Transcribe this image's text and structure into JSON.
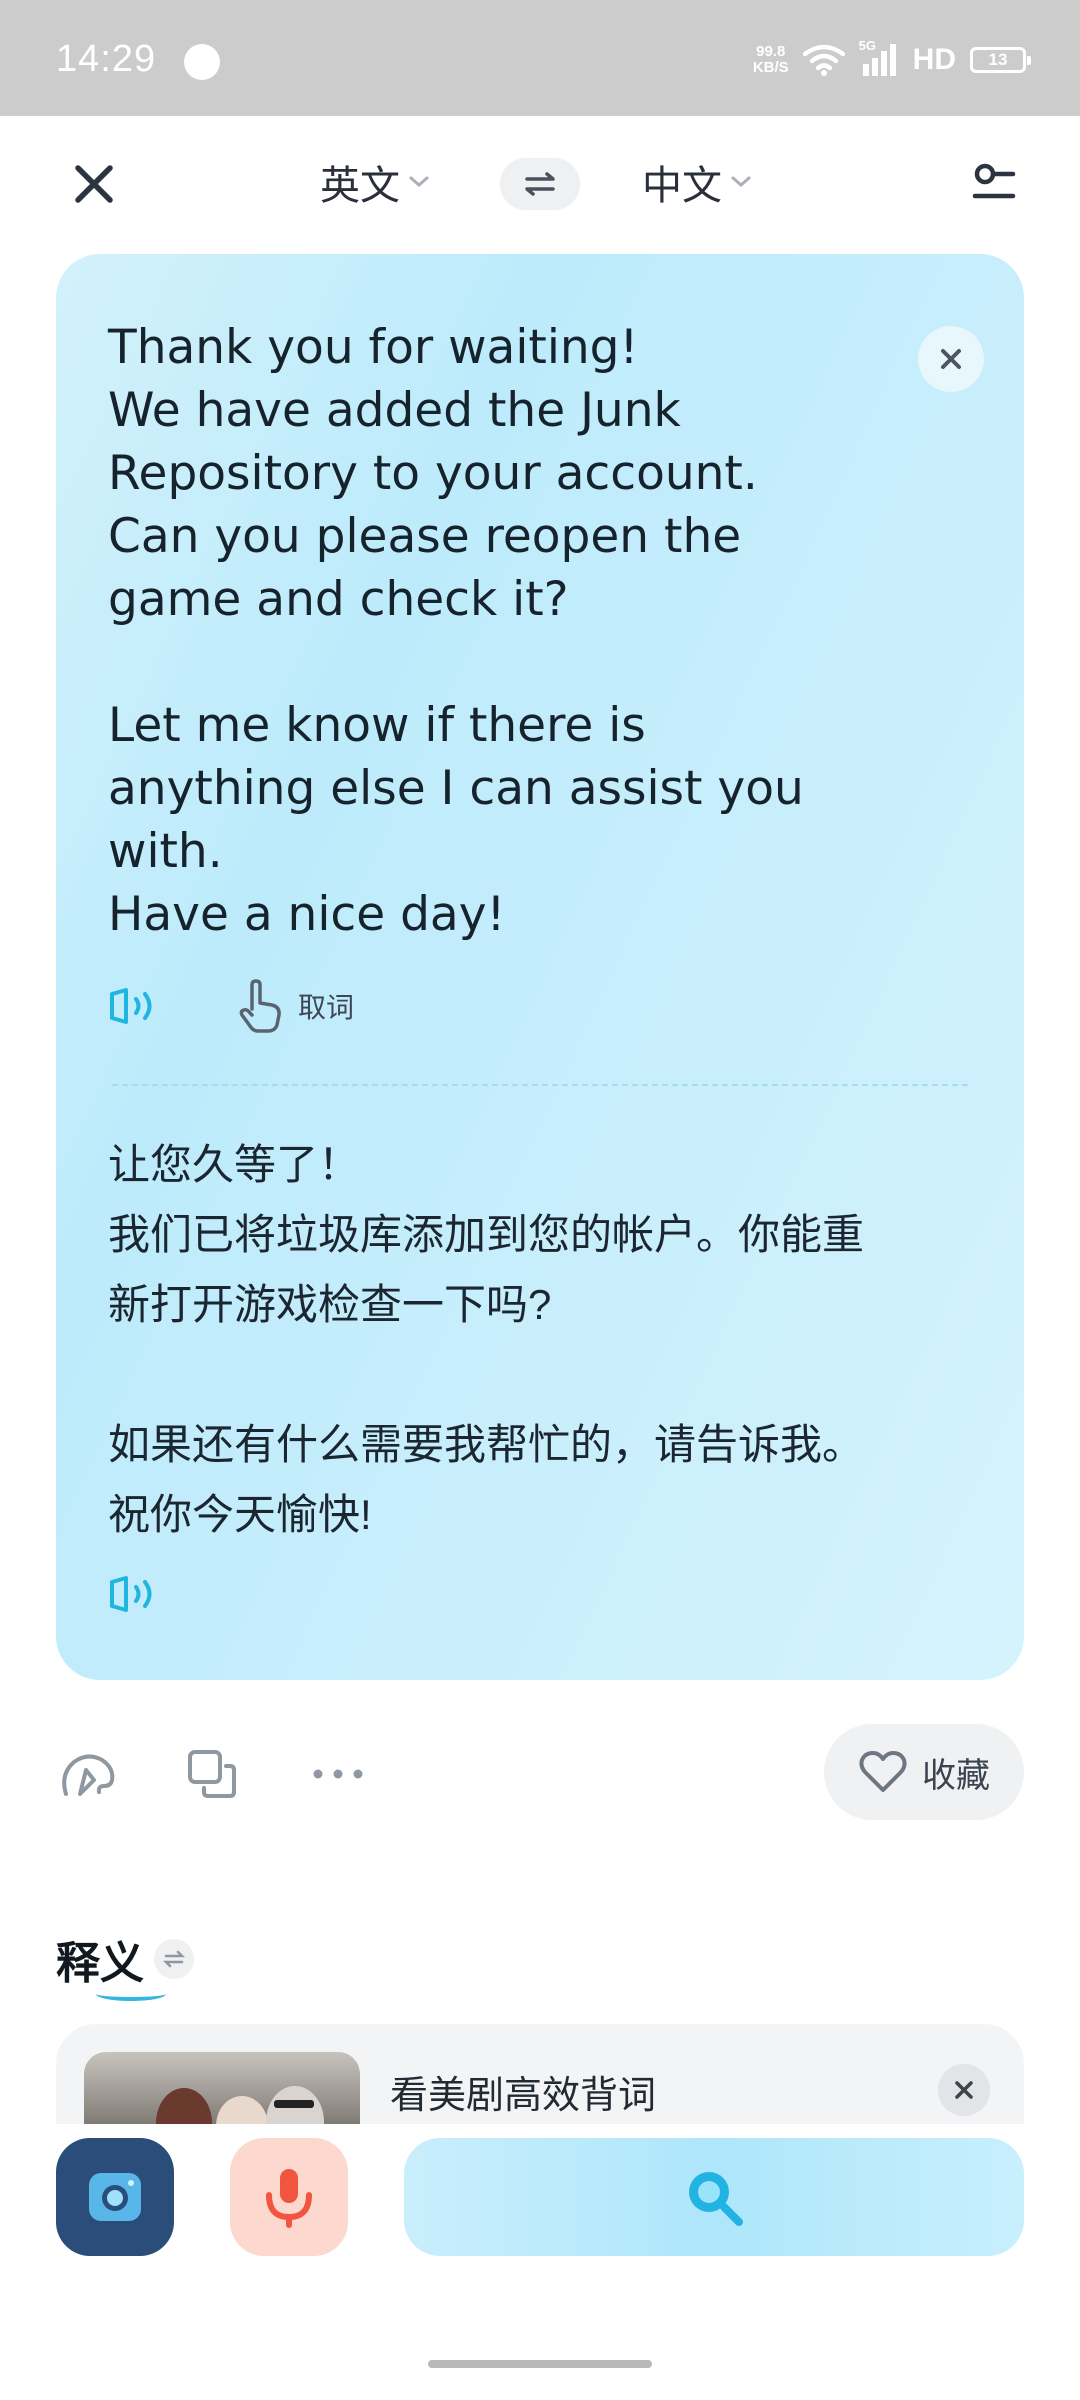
{
  "status_bar": {
    "time": "14:29",
    "net_speed_value": "99.8",
    "net_speed_unit": "KB/S",
    "network_type": "5G",
    "hd": "HD",
    "battery": "13"
  },
  "top_bar": {
    "source_lang": "英文",
    "target_lang": "中文"
  },
  "translation": {
    "source_lines": [
      "Thank you for waiting!",
      "We have added the Junk",
      "Repository to your account.",
      "Can you please reopen the",
      "game and check it?",
      "",
      "Let me know if there is",
      "anything else I can assist you",
      "with.",
      "Have a nice day!"
    ],
    "pick_word_label": "取词",
    "target_lines": [
      "让您久等了！",
      "我们已将垃圾库添加到您的帐户。你能重",
      "新打开游戏检查一下吗?",
      "",
      "如果还有什么需要我帮忙的，请告诉我。",
      "祝你今天愉快!"
    ]
  },
  "actions": {
    "favorite_label": "收藏"
  },
  "definition": {
    "title": "释义",
    "promo_text": "看美剧高效背词"
  },
  "colors": {
    "accent": "#1fb5e0",
    "card_bg": "#c4edfb",
    "camera_bg": "#2a4d7a",
    "mic_bg": "#fdd8cf",
    "mic_accent": "#f2553f"
  }
}
